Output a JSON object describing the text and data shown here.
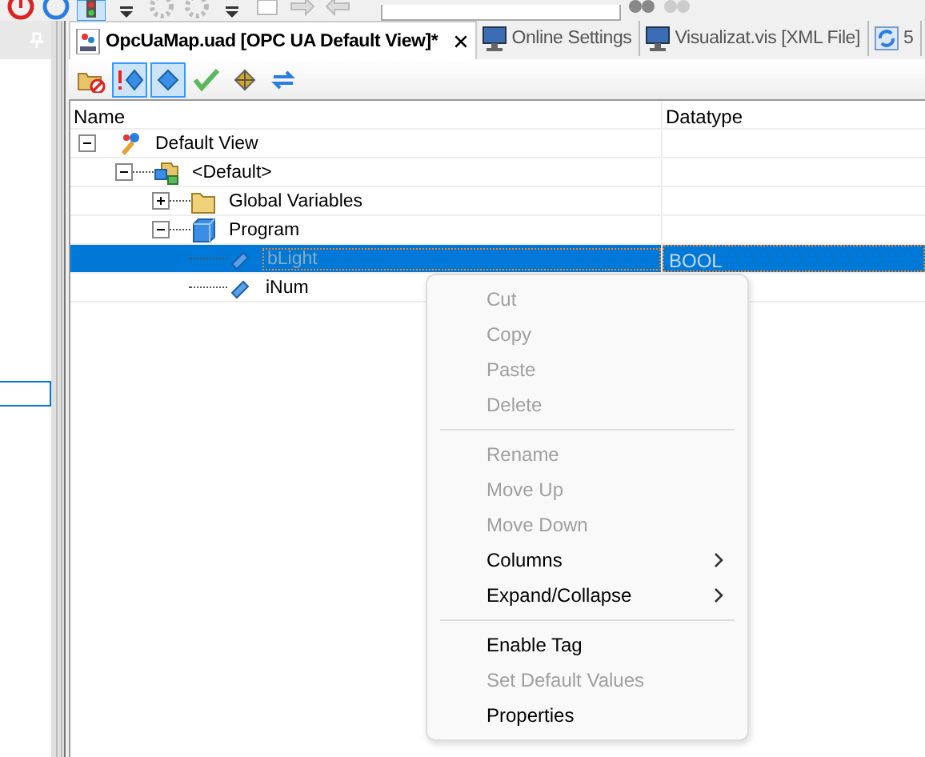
{
  "tabs": [
    {
      "label": "OpcUaMap.uad [OPC UA Default View]*",
      "selected": true
    },
    {
      "label": "Online Settings",
      "selected": false
    },
    {
      "label": "Visualizat.vis [XML File]",
      "selected": false
    },
    {
      "label": "5",
      "selected": false
    }
  ],
  "tree": {
    "columns": [
      "Name",
      "Datatype"
    ],
    "nodes": [
      {
        "label": "Default View",
        "kind": "view",
        "expanded": true,
        "selected": false,
        "children": [
          {
            "label": "<Default>",
            "kind": "group",
            "expanded": true,
            "selected": false,
            "children": [
              {
                "label": "Global Variables",
                "kind": "folder",
                "expanded": false,
                "selected": false
              },
              {
                "label": "Program",
                "kind": "program",
                "expanded": true,
                "selected": false,
                "children": [
                  {
                    "label": "bLight",
                    "kind": "tag",
                    "selected": true,
                    "datatype": "BOOL"
                  },
                  {
                    "label": "iNum",
                    "kind": "tag",
                    "selected": false
                  }
                ]
              }
            ]
          }
        ]
      }
    ]
  },
  "context_menu": [
    {
      "kind": "item",
      "label": "Cut",
      "disabled": true
    },
    {
      "kind": "item",
      "label": "Copy",
      "disabled": true
    },
    {
      "kind": "item",
      "label": "Paste",
      "disabled": true
    },
    {
      "kind": "item",
      "label": "Delete",
      "disabled": true
    },
    {
      "kind": "separator"
    },
    {
      "kind": "item",
      "label": "Rename",
      "disabled": true
    },
    {
      "kind": "item",
      "label": "Move Up",
      "disabled": true
    },
    {
      "kind": "item",
      "label": "Move Down",
      "disabled": true
    },
    {
      "kind": "submenu",
      "label": "Columns",
      "disabled": false
    },
    {
      "kind": "submenu",
      "label": "Expand/Collapse",
      "disabled": false
    },
    {
      "kind": "separator"
    },
    {
      "kind": "item",
      "label": "Enable Tag",
      "disabled": false
    },
    {
      "kind": "item",
      "label": "Set Default Values",
      "disabled": true
    },
    {
      "kind": "item",
      "label": "Properties",
      "disabled": false
    }
  ]
}
